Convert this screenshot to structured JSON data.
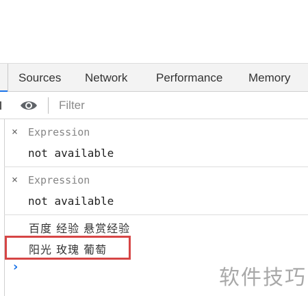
{
  "tabs": [
    "Sources",
    "Network",
    "Performance",
    "Memory"
  ],
  "filter": {
    "placeholder": "Filter"
  },
  "expressions": [
    {
      "close": "×",
      "label": "Expression",
      "value": "not available"
    },
    {
      "close": "×",
      "label": "Expression",
      "value": "not available"
    }
  ],
  "console_lines": [
    "百度 经验 悬赏经验",
    "阳光 玫瑰 葡萄"
  ],
  "prompt_symbol": "›",
  "watermark": "软件技巧",
  "colors": {
    "accent": "#1a73e8",
    "highlight": "#d64545"
  }
}
